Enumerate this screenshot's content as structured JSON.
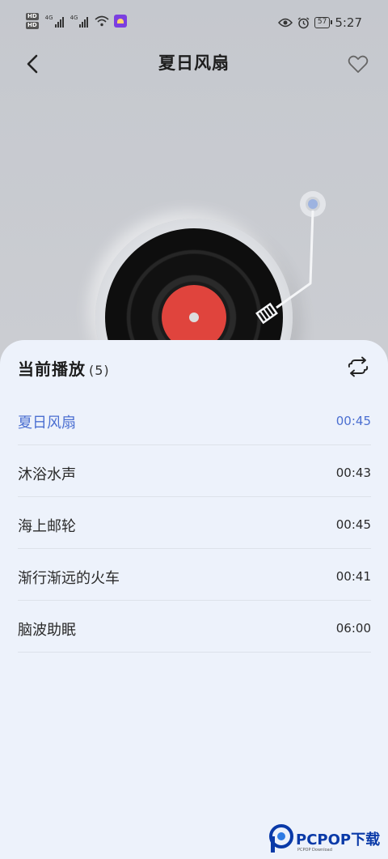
{
  "status_bar": {
    "hd_top": "HD",
    "hd_bottom": "HD",
    "net1": "4G",
    "net2": "4G",
    "battery": "57",
    "time": "5:27",
    "icons": [
      "signal-icon",
      "wifi-icon",
      "app-notification-icon",
      "eye-icon",
      "alarm-icon",
      "battery-icon"
    ]
  },
  "header": {
    "title": "夏日风扇",
    "back_icon": "chevron-left-icon",
    "favorite_icon": "heart-outline-icon"
  },
  "player": {
    "record_icon": "vinyl-record",
    "colors": {
      "record_label": "#e0443d",
      "record": "#111111"
    }
  },
  "playlist": {
    "title": "当前播放",
    "count": "(5)",
    "loop_icon": "loop-icon",
    "items": [
      {
        "name": "夏日风扇",
        "duration": "00:45",
        "active": true
      },
      {
        "name": "沐浴水声",
        "duration": "00:43",
        "active": false
      },
      {
        "name": "海上邮轮",
        "duration": "00:45",
        "active": false
      },
      {
        "name": "渐行渐远的火车",
        "duration": "00:41",
        "active": false
      },
      {
        "name": "脑波助眠",
        "duration": "06:00",
        "active": false
      }
    ],
    "colors": {
      "active": "#4b6fd1",
      "sheet_bg": "#edf2fb"
    }
  },
  "watermark": {
    "text": "PCPOP下载",
    "sub": "PCPOP Download"
  }
}
